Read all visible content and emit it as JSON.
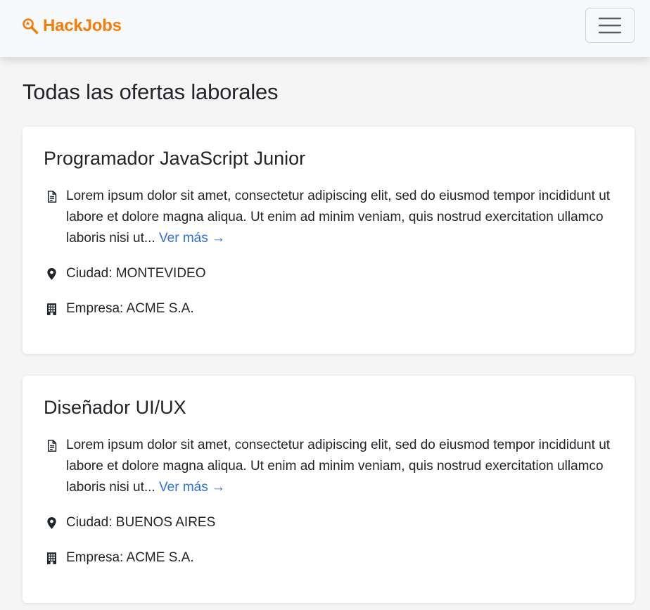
{
  "navbar": {
    "brand_name": "HackJobs",
    "brand_color": "#f27d0c",
    "brand_icon": "search-magnifier-icon",
    "menu_icon": "hamburger-menu-icon"
  },
  "page": {
    "title": "Todas las ofertas laborales"
  },
  "jobs": [
    {
      "title": "Programador JavaScript Junior",
      "description": "Lorem ipsum dolor sit amet, consectetur adipiscing elit, sed do eiusmod tempor incididunt ut labore et dolore magna aliqua. Ut enim ad minim veniam, quis nostrud exercitation ullamco laboris nisi ut...",
      "more_label": "Ver más →",
      "city": "Ciudad: MONTEVIDEO",
      "company": "Empresa: ACME S.A."
    },
    {
      "title": "Diseñador UI/UX",
      "description": "Lorem ipsum dolor sit amet, consectetur adipiscing elit, sed do eiusmod tempor incididunt ut labore et dolore magna aliqua. Ut enim ad minim veniam, quis nostrud exercitation ullamco laboris nisi ut...",
      "more_label": "Ver más →",
      "city": "Ciudad: BUENOS AIRES",
      "company": "Empresa: ACME S.A."
    }
  ],
  "icons": {
    "description": "document-icon",
    "city": "map-pin-icon",
    "company": "building-icon"
  },
  "colors": {
    "link": "#2f6fdb",
    "background": "#f5f5f5"
  }
}
